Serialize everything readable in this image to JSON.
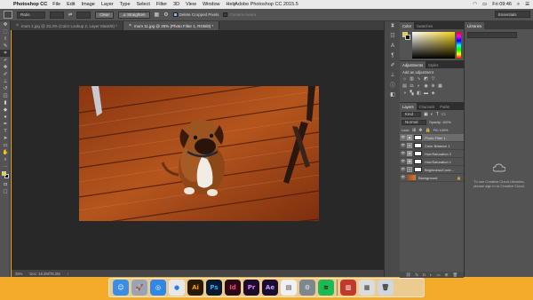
{
  "menubar": {
    "app_name": "Photoshop CC",
    "items": [
      "File",
      "Edit",
      "Image",
      "Layer",
      "Type",
      "Select",
      "Filter",
      "3D",
      "View",
      "Window",
      "Help"
    ],
    "window_title": "Adobe Photoshop CC 2015.5",
    "clock": "Fri 09:46"
  },
  "options": {
    "ratio_value": "Ratio",
    "clear_label": "Clear",
    "straighten_label": "Straighten",
    "delete_cropped_label": "Delete Cropped Pixels",
    "content_aware_label": "Content-Aware",
    "workspace_label": "Essentials"
  },
  "tabs": [
    {
      "label": "mum 1.jpg @ 33.3% (Color Lookup 2, Layer Mask/8) *"
    },
    {
      "label": "mum 11.jpg @ 25% (Photo Filter 1, RGB/8) *"
    }
  ],
  "status": {
    "zoom": "25%",
    "doc": "Doc: 18.2M/78.2M"
  },
  "panels": {
    "color_tabs": [
      "Color",
      "Swatches"
    ],
    "adjust_tabs": [
      "Adjustments",
      "Styles"
    ],
    "adjust_title": "Add an adjustment",
    "layers_tabs": [
      "Layers",
      "Channels",
      "Paths"
    ],
    "kind_label": "Kind",
    "blend_mode": "Normal",
    "opacity_label": "Opacity: 100%",
    "lock_label": "Lock:",
    "fill_label": "Fill: 100%",
    "layers": [
      {
        "name": "Photo Filter 1",
        "selected": true
      },
      {
        "name": "Color Balance 1",
        "selected": false
      },
      {
        "name": "Hue/Saturation 2",
        "selected": false
      },
      {
        "name": "Hue/Saturation 1",
        "selected": false
      },
      {
        "name": "Brightness/Contr...",
        "selected": false
      },
      {
        "name": "Background",
        "selected": false
      }
    ]
  },
  "libraries": {
    "title": "Libraries",
    "message": "To use Creative Cloud Libraries, please sign in to Creative Cloud."
  },
  "dock": [
    {
      "name": "Finder",
      "glyph": "☺",
      "bg": "#3a8ee6",
      "fg": "#fff"
    },
    {
      "name": "Launchpad",
      "glyph": "🚀",
      "bg": "#9aa4b2",
      "fg": "#222"
    },
    {
      "name": "Safari",
      "glyph": "◎",
      "bg": "#2f87e8",
      "fg": "#fff"
    },
    {
      "name": "Chrome",
      "glyph": "●",
      "bg": "#e8e8e8",
      "fg": "#2a7fe0"
    },
    {
      "name": "Illustrator",
      "glyph": "Ai",
      "bg": "#2a1a05",
      "fg": "#ff9a00"
    },
    {
      "name": "Photoshop",
      "glyph": "Ps",
      "bg": "#061a2f",
      "fg": "#31a8ff"
    },
    {
      "name": "InDesign",
      "glyph": "Id",
      "bg": "#2b0a17",
      "fg": "#ff3d7f"
    },
    {
      "name": "Premiere",
      "glyph": "Pr",
      "bg": "#1c0b2b",
      "fg": "#e07bff"
    },
    {
      "name": "After Effects",
      "glyph": "Ae",
      "bg": "#1a0c2e",
      "fg": "#b9a2ff"
    },
    {
      "name": "Preview",
      "glyph": "▤",
      "bg": "#f0f0f0",
      "fg": "#333"
    },
    {
      "name": "System Preferences",
      "glyph": "⚙",
      "bg": "#7d8790",
      "fg": "#eee"
    },
    {
      "name": "Spotify",
      "glyph": "≋",
      "bg": "#1db954",
      "fg": "#111"
    },
    {
      "name": "Photo Booth",
      "glyph": "▥",
      "bg": "#c0392b",
      "fg": "#fff"
    },
    {
      "name": "Finder Window",
      "glyph": "▦",
      "bg": "#dcdcdc",
      "fg": "#333"
    },
    {
      "name": "Trash",
      "glyph": "🗑",
      "bg": "#cfd6dc",
      "fg": "#444"
    }
  ],
  "colors": {
    "accent": "#f4ab2a",
    "fg_swatch": "#f5d100",
    "bg_swatch": "#111111"
  }
}
